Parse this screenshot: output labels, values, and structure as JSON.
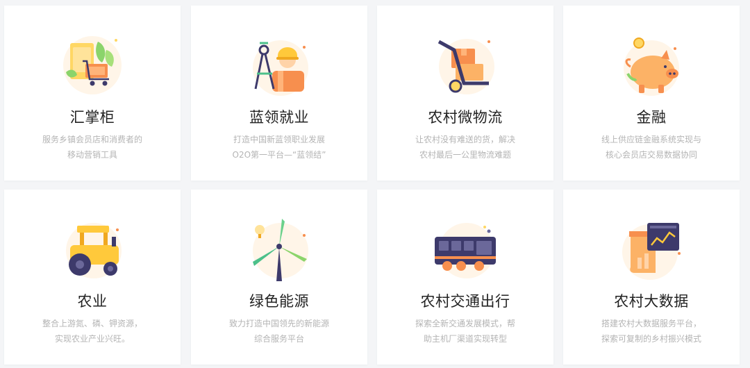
{
  "cards": [
    {
      "title": "汇掌柜",
      "desc1": "服务乡镇会员店和消费者的",
      "desc2": "移动营销工具",
      "icon": "cart-icon"
    },
    {
      "title": "蓝领就业",
      "desc1": "打造中国新蓝领职业发展",
      "desc2": "O2O第一平台—“蓝领结”",
      "icon": "worker-icon"
    },
    {
      "title": "农村微物流",
      "desc1": "让农村没有难送的货，解决",
      "desc2": "农村最后一公里物流难题",
      "icon": "hand-truck-icon"
    },
    {
      "title": "金融",
      "desc1": "线上供应链金融系统实现与",
      "desc2": "核心会员店交易数据协同",
      "icon": "piggy-bank-icon"
    },
    {
      "title": "农业",
      "desc1": "整合上游氮、磷、钾资源，",
      "desc2": "实现农业产业兴旺。",
      "icon": "tractor-icon"
    },
    {
      "title": "绿色能源",
      "desc1": "致力打造中国领先的新能源",
      "desc2": "综合服务平台",
      "icon": "wind-turbine-icon"
    },
    {
      "title": "农村交通出行",
      "desc1": "探索全新交通发展模式，帮",
      "desc2": "助主机厂渠道实现转型",
      "icon": "bus-icon"
    },
    {
      "title": "农村大数据",
      "desc1": "搭建农村大数据服务平台，",
      "desc2": "探索可复制的乡村振兴模式",
      "icon": "data-chart-icon"
    }
  ]
}
